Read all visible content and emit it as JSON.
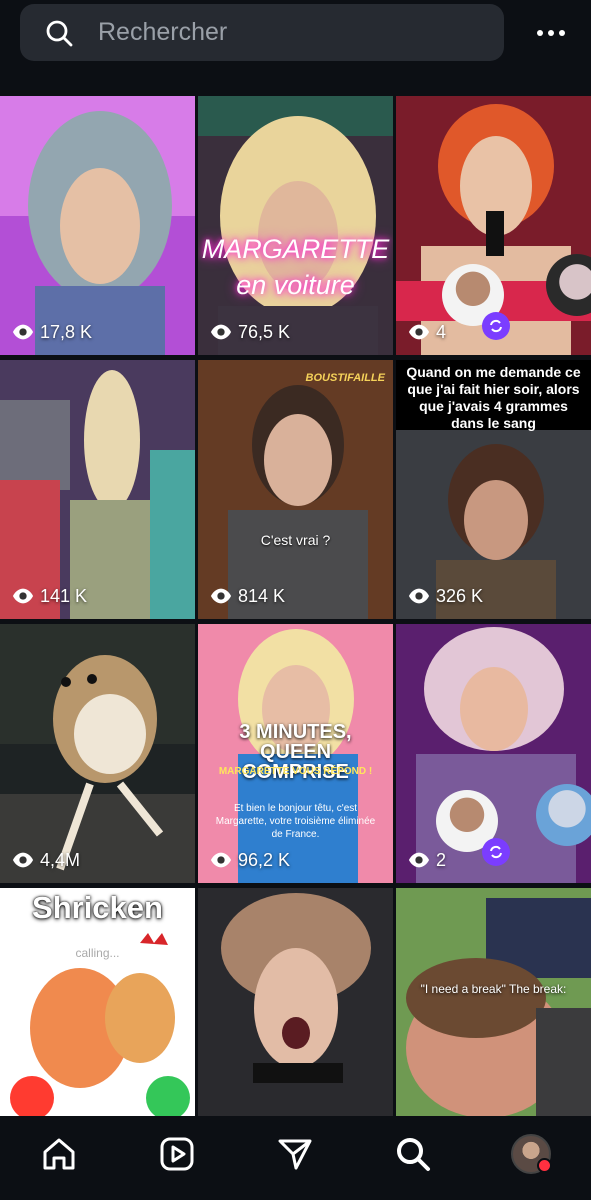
{
  "search": {
    "placeholder": "Rechercher"
  },
  "tiles": [
    {
      "views": "17,8 K"
    },
    {
      "views": "76,5 K",
      "overlay": "MARGARETTE en voiture"
    },
    {
      "views": "4"
    },
    {
      "views": "141 K"
    },
    {
      "views": "814 K",
      "overlay": "C'est vrai ?",
      "logo": "BOUSTIFAILLE"
    },
    {
      "views": "326 K",
      "overlay": "Quand on me demande ce que j'ai fait hier soir, alors que j'avais 4 grammes dans le sang"
    },
    {
      "views": "4,4M"
    },
    {
      "views": "96,2 K",
      "overlay": "3 MINUTES, QUEEN COMPRISE",
      "subtitle": "MARGARETTE VOUS RÉPOND !",
      "body": "Et bien le bonjour têtu, c'est Margarette, votre troisième éliminée de France."
    },
    {
      "views": "2"
    },
    {
      "overlay": "Shricken",
      "subtitle": "calling..."
    },
    {},
    {
      "overlay": "\"I need a break\" The break:"
    }
  ],
  "nav": {
    "items": [
      "home-icon",
      "reels-icon",
      "send-icon",
      "search-icon",
      "profile-avatar"
    ]
  },
  "colors": {
    "background": "#0c0f14",
    "search_bg": "#262a31",
    "accent": "#7b3dff",
    "notification": "#ff3040"
  }
}
